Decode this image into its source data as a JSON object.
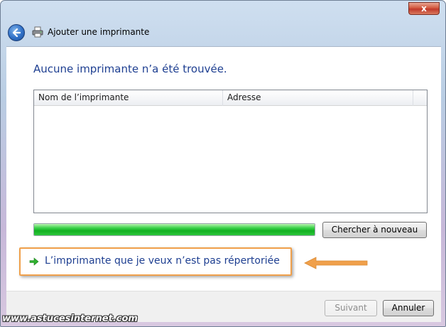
{
  "window": {
    "title": "Ajouter une imprimante",
    "close_label": "x"
  },
  "main": {
    "heading": "Aucune imprimante n’a été trouvée.",
    "table": {
      "columns": [
        {
          "label": "Nom de l’imprimante"
        },
        {
          "label": "Adresse"
        }
      ],
      "rows": []
    },
    "progress": {
      "value": 1.0,
      "color": "#12b021"
    },
    "search_again_label": "Chercher à nouveau",
    "not_listed_link": "L’imprimante que je veux n’est pas répertoriée",
    "annotation_color": "#f0a04b"
  },
  "footer": {
    "next_label": "Suivant",
    "cancel_label": "Annuler"
  },
  "watermark": "www.astucesinternet.com",
  "icons": {
    "back": "back-arrow-icon",
    "printer": "printer-icon",
    "link_arrow": "green-arrow-icon",
    "annotation_arrow": "orange-arrow-icon"
  }
}
